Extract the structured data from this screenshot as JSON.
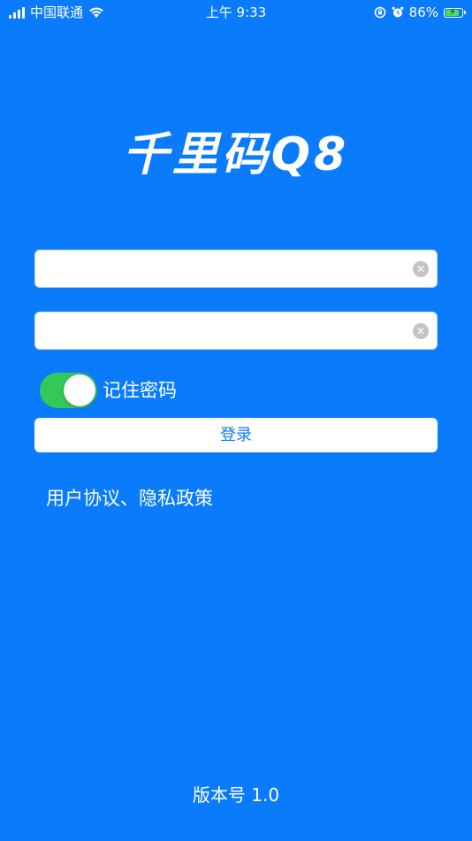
{
  "status_bar": {
    "carrier": "中国联通",
    "time": "上午 9:33",
    "battery_percent": "86%",
    "battery_level": 0.86,
    "icons": [
      "signal-icon",
      "wifi-icon",
      "orientation-lock-icon",
      "alarm-icon",
      "battery-icon"
    ]
  },
  "app": {
    "title": "千里码Q8"
  },
  "login_form": {
    "username_value": "",
    "password_value": "",
    "clear_glyph": "✕",
    "remember_label": "记住密码",
    "remember_on": true,
    "login_label": "登录"
  },
  "links": {
    "policy": "用户协议、隐私政策"
  },
  "footer": {
    "version": "版本号 1.0"
  },
  "colors": {
    "background": "#0A7BFB",
    "toggle_on": "#34C759",
    "button_text": "#0A7BFB"
  }
}
